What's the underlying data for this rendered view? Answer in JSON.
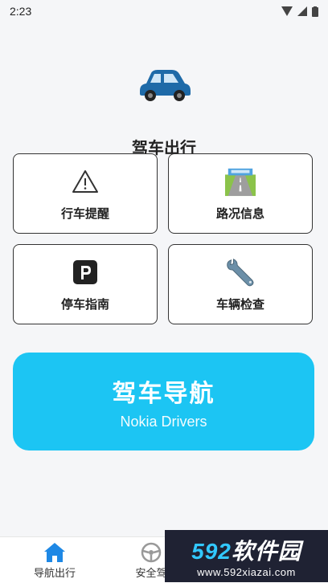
{
  "status_bar": {
    "time": "2:23"
  },
  "header": {
    "title": "驾车出行"
  },
  "cards": [
    {
      "label": "行车提醒",
      "icon": "warning-icon"
    },
    {
      "label": "路况信息",
      "icon": "road-icon"
    },
    {
      "label": "停车指南",
      "icon": "parking-icon"
    },
    {
      "label": "车辆检查",
      "icon": "wrench-icon"
    }
  ],
  "nav_button": {
    "title": "驾车导航",
    "subtitle": "Nokia Drivers"
  },
  "bottom_nav": {
    "items": [
      {
        "label": "导航出行",
        "icon": "home-icon"
      },
      {
        "label": "安全驾",
        "icon": "steering-wheel-icon"
      }
    ]
  },
  "watermark": {
    "brand_num": "592",
    "brand_text": "软件园",
    "url": "www.592xiazai.com"
  },
  "colors": {
    "accent": "#1cc5f3",
    "car": "#1e6aa8",
    "watermark_bg": "#1f2233"
  }
}
